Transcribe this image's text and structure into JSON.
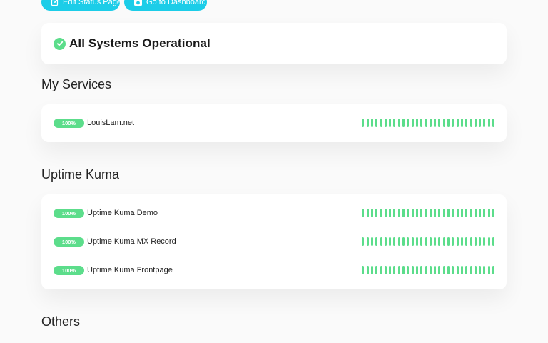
{
  "toolbar": {
    "edit_label": "Edit Status Page",
    "dashboard_label": "Go to Dashboard",
    "button_color": "#1ccde8"
  },
  "overall_status": {
    "text": "All Systems Operational",
    "color": "#5cdd8b",
    "icon": "check-circle-icon"
  },
  "groups": [
    {
      "title": "My Services",
      "monitors": [
        {
          "uptime": "100%",
          "name": "LouisLam.net"
        }
      ]
    },
    {
      "title": "Uptime Kuma",
      "monitors": [
        {
          "uptime": "100%",
          "name": "Uptime Kuma Demo"
        },
        {
          "uptime": "100%",
          "name": "Uptime Kuma MX Record"
        },
        {
          "uptime": "100%",
          "name": "Uptime Kuma Frontpage"
        }
      ]
    },
    {
      "title": "Others",
      "monitors": []
    }
  ],
  "heartbeat": {
    "status": "up",
    "color": "#5cdd8b"
  }
}
